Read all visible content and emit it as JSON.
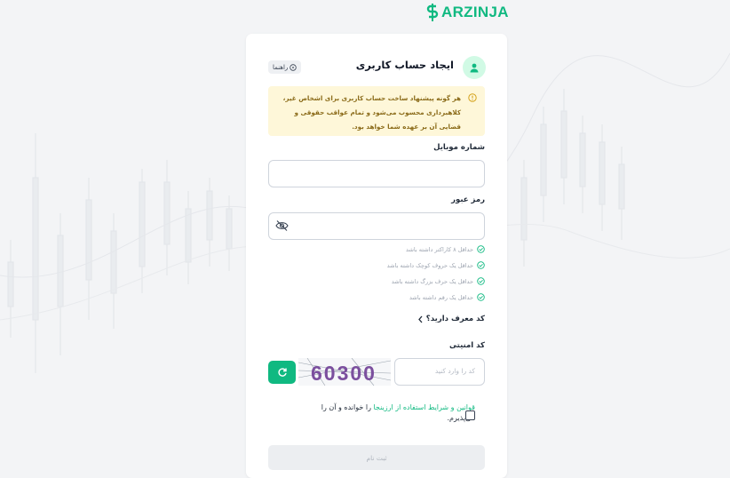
{
  "brand": {
    "name": "ARZINJA",
    "color": "#10b981",
    "icon": "dollar-s-icon"
  },
  "header": {
    "title": "ایجاد حساب کاربری",
    "help_label": "راهنما",
    "avatar_icon": "user-icon"
  },
  "warning": {
    "text": "هر گونه پیشنهاد ساخت حساب کاربری برای اشخاص غیر، کلاهبرداری محسوب می‌شود و تمام عواقب حقوقی و قضایی آن بر عهده شما خواهد بود.",
    "icon": "info-icon"
  },
  "form": {
    "mobile": {
      "label": "شماره موبایل",
      "value": ""
    },
    "password": {
      "label": "رمز عبور",
      "value": "",
      "toggle_icon": "eye-off-icon",
      "rules": [
        "حداقل ۸ کاراکتر داشته باشد",
        "حداقل یک حروف کوچک داشته باشد",
        "حداقل یک حرف بزرگ داشته باشد",
        "حداقل یک رقم داشته باشد"
      ]
    },
    "referral": {
      "label": "کد معرف دارید؟"
    },
    "captcha": {
      "label": "کد امنیتی",
      "placeholder": "کد را وارد کنید",
      "image_text": "60300",
      "refresh_icon": "refresh-icon"
    },
    "terms": {
      "link_text": "قوانین و شرایط استفاده از ارزینجا",
      "rest_text": " را خوانده و آن را می‌پذیرم.",
      "checked": false
    },
    "submit_label": "ثبت نام"
  }
}
